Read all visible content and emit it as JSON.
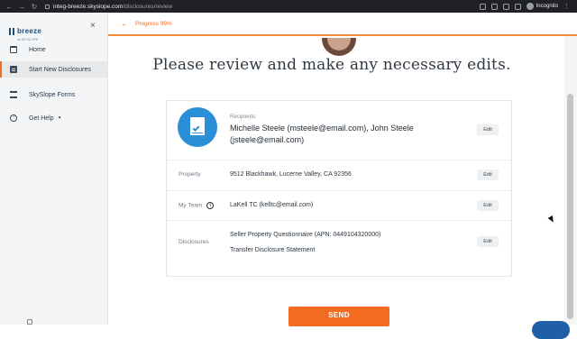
{
  "browser": {
    "url_host": "integ-breeze.skyslope.com",
    "url_path": "/disclosures/review",
    "profile": "Incognito"
  },
  "sidebar": {
    "logo_word": "breeze",
    "logo_sub": "by SKYSLOPE",
    "items": [
      {
        "label": "Home",
        "icon": "home-icon"
      },
      {
        "label": "Start New Disclosures",
        "icon": "document-icon"
      },
      {
        "label": "SkySlope Forms",
        "icon": "forms-icon"
      },
      {
        "label": "Get Help",
        "icon": "help-icon"
      }
    ]
  },
  "header": {
    "progress_text": "Progress 99%",
    "progress": 0.99
  },
  "main": {
    "headline": "Please review and make any necessary edits."
  },
  "review": {
    "recipients": {
      "label": "Recipients:",
      "value": "Michelle Steele (msteele@email.com), John Steele (jsteele@email.com)",
      "edit": "Edit"
    },
    "property": {
      "label": "Property",
      "value": "9512 Blackhawk, Lucerne Valley, CA 92356",
      "edit": "Edit"
    },
    "team": {
      "label": "My Team",
      "value": "LaKell TC (kelltc@email.com)",
      "edit": "Edit"
    },
    "disclosures": {
      "label": "Disclosures",
      "items": [
        "Seller Property Questionnaire (APN: 0449104320000)",
        "Transfer Disclosure Statement"
      ],
      "edit": "Edit"
    }
  },
  "actions": {
    "send_label": "SEND"
  },
  "colors": {
    "accent": "#f26b21",
    "recipient_icon": "#2a8fd6"
  }
}
